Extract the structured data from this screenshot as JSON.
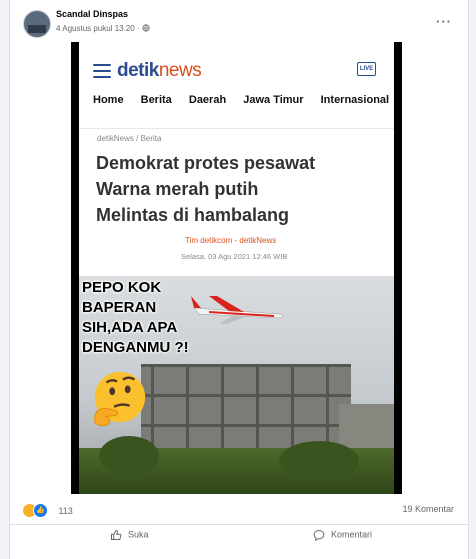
{
  "post": {
    "author": "Scandal Dinspas",
    "timestamp": "4 Agustus pukul 13.20",
    "privacy_icon": "globe-icon",
    "more_icon": "more-options-icon",
    "more_label": "···"
  },
  "detik": {
    "logo_main": "detik",
    "logo_news": "news",
    "live_label": "LIVE",
    "nav": [
      "Home",
      "Berita",
      "Daerah",
      "Jawa Timur",
      "Internasional"
    ],
    "breadcrumb": "detikNews / Berita",
    "headline_lines": [
      "Demokrat protes pesawat",
      "Warna merah putih",
      "Melintas di hambalang"
    ],
    "byline": "Tim detikcom - detikNews",
    "date": "Selasa, 03 Agu 2021 12:46 WIB"
  },
  "overlay": {
    "lines": [
      "PEPO KOK",
      "BAPERAN",
      "SIH,ADA APA",
      "DENGANMU ?!"
    ],
    "emoji_icon": "thinking-face-icon"
  },
  "stats": {
    "reaction_count": "113",
    "comments_label": "19 Komentar"
  },
  "actions": {
    "like_label": "Suka",
    "comment_label": "Komentari"
  },
  "colors": {
    "detik_blue": "#2a4d8f",
    "detik_orange": "#d94f1e",
    "facebook_blue": "#1877f2"
  }
}
